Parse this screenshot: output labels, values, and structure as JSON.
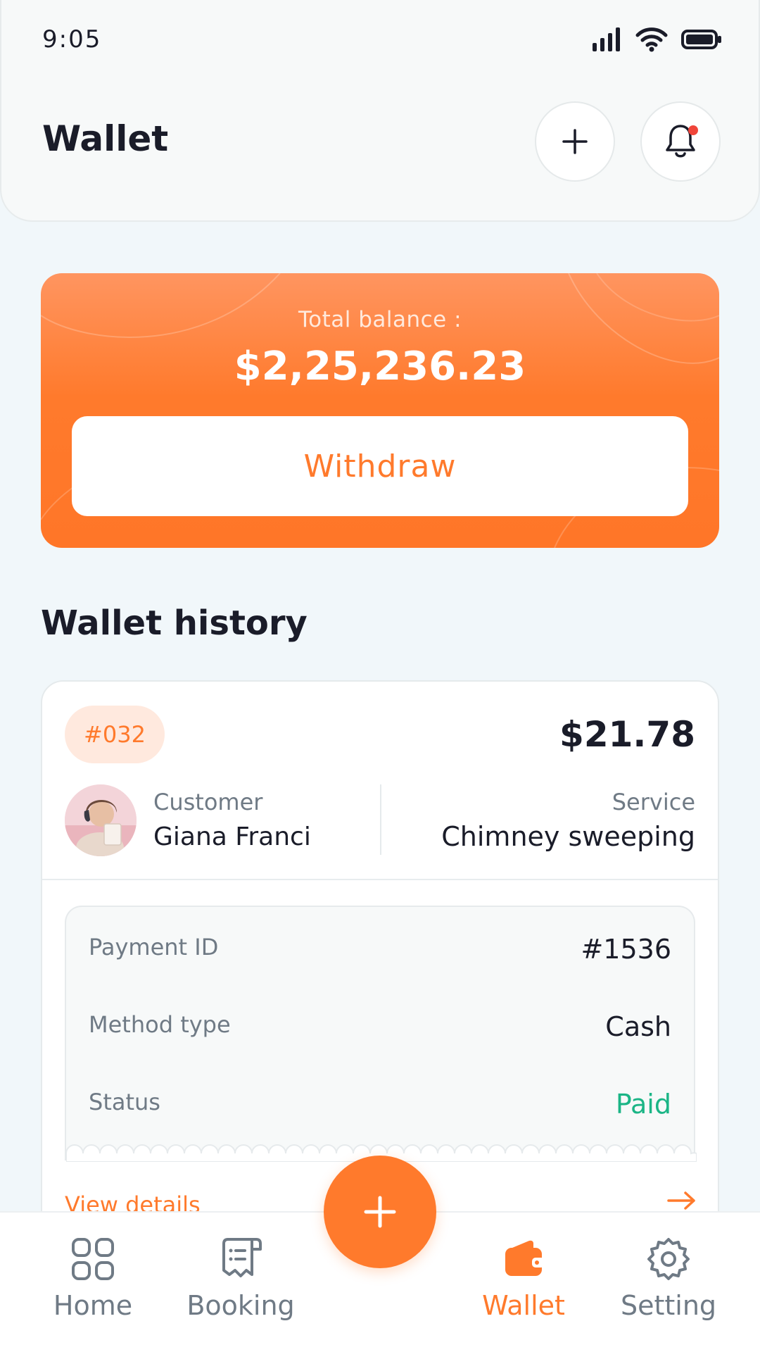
{
  "status_bar": {
    "time": "9:05"
  },
  "header": {
    "title": "Wallet"
  },
  "balance": {
    "label": "Total balance  :",
    "amount": "$2,25,236.23",
    "withdraw_label": "Withdraw"
  },
  "history": {
    "section_title": "Wallet history",
    "items": [
      {
        "order_id": "#032",
        "amount": "$21.78",
        "customer_label": "Customer",
        "customer_name": "Giana Franci",
        "service_label": "Service",
        "service_name": "Chimney sweeping",
        "details": [
          {
            "label": "Payment ID",
            "value": "#1536"
          },
          {
            "label": "Method type",
            "value": "Cash"
          },
          {
            "label": "Status",
            "value": "Paid"
          }
        ],
        "view_details_label": "View details"
      }
    ]
  },
  "nav": {
    "items": [
      {
        "label": "Home",
        "icon": "grid-icon"
      },
      {
        "label": "Booking",
        "icon": "receipt-icon"
      },
      {
        "label": "Wallet",
        "icon": "wallet-icon",
        "active": true
      },
      {
        "label": "Setting",
        "icon": "gear-icon"
      }
    ]
  },
  "colors": {
    "accent": "#ff7a2c",
    "paid": "#1bb586",
    "text_primary": "#1a1c29",
    "text_secondary": "#6f7a85",
    "background": "#f1f7fa"
  }
}
